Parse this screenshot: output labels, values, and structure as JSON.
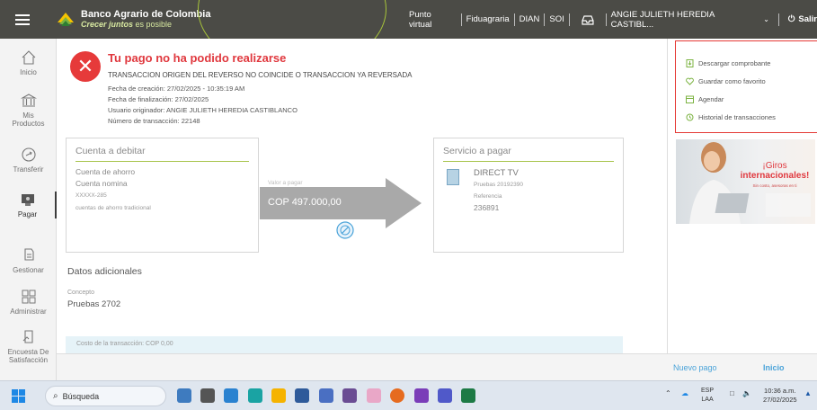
{
  "header": {
    "brand_title": "Banco Agrario de Colombia",
    "brand_slogan_bold": "Crecer juntos",
    "brand_slogan_rest": " es posible",
    "nav": [
      "Punto virtual",
      "Fiduagraria",
      "DIAN",
      "SOI"
    ],
    "user_name": "ANGIE JULIETH HEREDIA CASTIBL...",
    "logout_label": "Salir"
  },
  "sidebar": {
    "items": [
      {
        "label": "Inicio",
        "icon": "home-icon"
      },
      {
        "label_1": "Mis",
        "label_2": "Productos",
        "icon": "bank-icon"
      },
      {
        "label": "Transferir",
        "icon": "transfer-icon"
      },
      {
        "label": "Pagar",
        "icon": "pay-icon"
      },
      {
        "label": "Gestionar",
        "icon": "manage-icon"
      },
      {
        "label": "Administrar",
        "icon": "grid-icon"
      },
      {
        "label_1": "Encuesta De",
        "label_2": "Satisfacción",
        "icon": "survey-icon"
      }
    ]
  },
  "result": {
    "title": "Tu pago no ha podido realizarse",
    "message": "TRANSACCION ORIGEN DEL REVERSO NO COINCIDE O TRANSACCION YA REVERSADA",
    "created": "Fecha de creación: 27/02/2025 - 10:35:19 AM",
    "finished": "Fecha de finalización: 27/02/2025",
    "user": "Usuario originador: ANGIE JULIETH HEREDIA CASTIBLANCO",
    "transaction": "Número de transacción: 22148"
  },
  "debit": {
    "title": "Cuenta a debitar",
    "type": "Cuenta de ahorro",
    "name": "Cuenta nomina",
    "number": "XXXXX-285",
    "desc": "cuentas de ahorro tradicional"
  },
  "transfer": {
    "value_label": "Valor a pagar",
    "amount": "COP 497.000,00"
  },
  "service": {
    "title": "Servicio a pagar",
    "name": "DIRECT TV",
    "detail": "Pruebas 20192390",
    "ref_label": "Referencia",
    "ref_value": "236891"
  },
  "additional": {
    "title": "Datos adicionales",
    "concept_label": "Concepto",
    "concept_value": "Pruebas 2702",
    "cost": "Costo de la transacción: COP 0,00"
  },
  "actions": [
    {
      "label": "Descargar comprobante",
      "icon": "download-icon"
    },
    {
      "label": "Guardar como favorito",
      "icon": "heart-icon"
    },
    {
      "label": "Agendar",
      "icon": "calendar-icon"
    },
    {
      "label": "Historial de transacciones",
      "icon": "history-icon"
    }
  ],
  "promo": {
    "line1": "¡Giros",
    "line2": "internacionales!",
    "small": "Sin costo, asesoras en ti"
  },
  "footer": {
    "new_payment": "Nuevo pago",
    "home": "Inicio"
  },
  "taskbar": {
    "search": "Búsqueda",
    "lang_1": "ESP",
    "lang_2": "LAA",
    "time": "10:36 a.m.",
    "date": "27/02/2025"
  },
  "colors": {
    "topbar": "#4b4b46",
    "error": "#e0383e",
    "accent_green": "#a7c44b",
    "link_blue": "#4aa3d9",
    "highlight_box": "#e53935"
  }
}
